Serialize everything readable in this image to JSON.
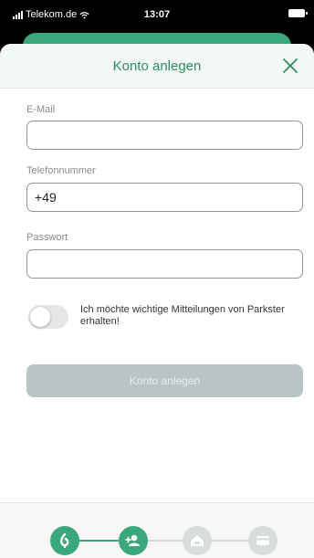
{
  "status_bar": {
    "carrier": "Telekom.de",
    "time": "13:07"
  },
  "sheet": {
    "title": "Konto anlegen"
  },
  "form": {
    "email": {
      "label": "E-Mail",
      "value": ""
    },
    "phone": {
      "label": "Telefonnummer",
      "value": "+49"
    },
    "password": {
      "label": "Passwort",
      "value": ""
    },
    "toggle": {
      "label": "Ich möchte wichtige Mitteilungen von Parkster erhalten!",
      "on": false
    },
    "submit_label": "Konto anlegen"
  },
  "stepper": {
    "steps": [
      {
        "icon": "parkster-logo-icon",
        "state": "done"
      },
      {
        "icon": "add-person-icon",
        "state": "active"
      },
      {
        "icon": "car-home-icon",
        "state": "pending"
      },
      {
        "icon": "credit-card-icon",
        "state": "pending"
      }
    ]
  },
  "colors": {
    "brand_green": "#3aa77d",
    "title_green": "#2e8c63",
    "pending_gray": "#d7dcdc",
    "button_disabled": "#b8c4c5"
  }
}
